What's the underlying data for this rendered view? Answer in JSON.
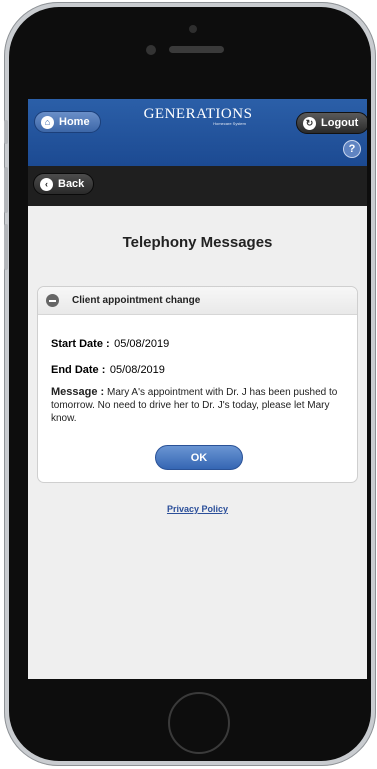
{
  "header": {
    "home_label": "Home",
    "logo_main": "GENERATIONS",
    "logo_sub": "Homecare System",
    "logout_label": "Logout",
    "help_label": "?"
  },
  "nav": {
    "back_label": "Back"
  },
  "page": {
    "title": "Telephony Messages"
  },
  "message_card": {
    "heading": "Client appointment change",
    "start_label": "Start Date :",
    "start_value": "05/08/2019",
    "end_label": "End Date :",
    "end_value": "05/08/2019",
    "message_label": "Message :",
    "message_value": "Mary A's appointment with Dr. J has been pushed to tomorrow. No need to drive her to Dr. J's today, please let Mary know.",
    "ok_label": "OK"
  },
  "footer": {
    "privacy_label": "Privacy Policy"
  },
  "colors": {
    "header_blue": "#2b5fa8",
    "back_bar": "#1f1f1f",
    "link": "#2b4f9a"
  }
}
